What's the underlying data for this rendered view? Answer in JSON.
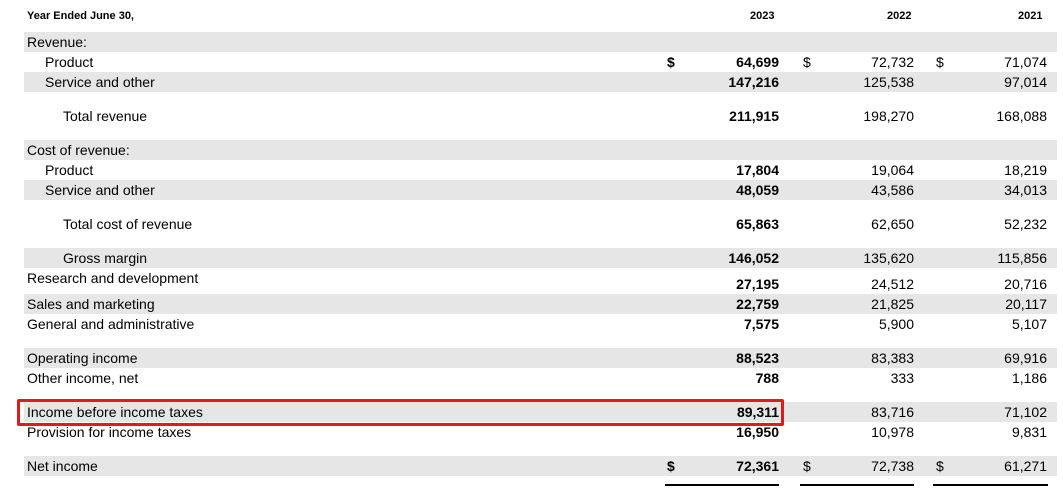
{
  "header": {
    "label": "Year Ended June 30,",
    "years": [
      "2023",
      "2022",
      "2021"
    ]
  },
  "currency_symbol": "$",
  "rows": [
    {
      "label": "Revenue:",
      "values": [
        "",
        "",
        ""
      ]
    },
    {
      "label": "Product",
      "values": [
        "64,699",
        "72,732",
        "71,074"
      ]
    },
    {
      "label": "Service and other",
      "values": [
        "147,216",
        "125,538",
        "97,014"
      ]
    },
    {
      "label": "Total revenue",
      "values": [
        "211,915",
        "198,270",
        "168,088"
      ]
    },
    {
      "label": "Cost of revenue:",
      "values": [
        "",
        "",
        ""
      ]
    },
    {
      "label": "Product",
      "values": [
        "17,804",
        "19,064",
        "18,219"
      ]
    },
    {
      "label": "Service and other",
      "values": [
        "48,059",
        "43,586",
        "34,013"
      ]
    },
    {
      "label": "Total cost of revenue",
      "values": [
        "65,863",
        "62,650",
        "52,232"
      ]
    },
    {
      "label": "Gross margin",
      "values": [
        "146,052",
        "135,620",
        "115,856"
      ]
    },
    {
      "label": "Research and development",
      "values": [
        "27,195",
        "24,512",
        "20,716"
      ]
    },
    {
      "label": "Sales and marketing",
      "values": [
        "22,759",
        "21,825",
        "20,117"
      ]
    },
    {
      "label": "General and administrative",
      "values": [
        "7,575",
        "5,900",
        "5,107"
      ]
    },
    {
      "label": "Operating income",
      "values": [
        "88,523",
        "83,383",
        "69,916"
      ]
    },
    {
      "label": "Other income, net",
      "values": [
        "788",
        "333",
        "1,186"
      ]
    },
    {
      "label": "Income before income taxes",
      "values": [
        "89,311",
        "83,716",
        "71,102"
      ]
    },
    {
      "label": "Provision for income taxes",
      "values": [
        "16,950",
        "10,978",
        "9,831"
      ]
    },
    {
      "label": "Net income",
      "values": [
        "72,361",
        "72,738",
        "61,271"
      ]
    }
  ],
  "highlight_color": "#e01b1b"
}
